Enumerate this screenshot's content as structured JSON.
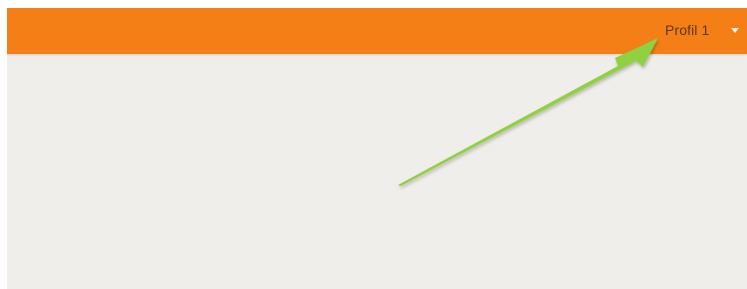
{
  "app": {
    "header": {
      "background_color": "#f57f17",
      "profile_menu": {
        "label": "Profil 1",
        "icon": "caret-down-icon"
      }
    },
    "content": {
      "background_color": "#efeeea"
    },
    "annotation": {
      "type": "arrow",
      "color": "#8fd13f"
    }
  }
}
